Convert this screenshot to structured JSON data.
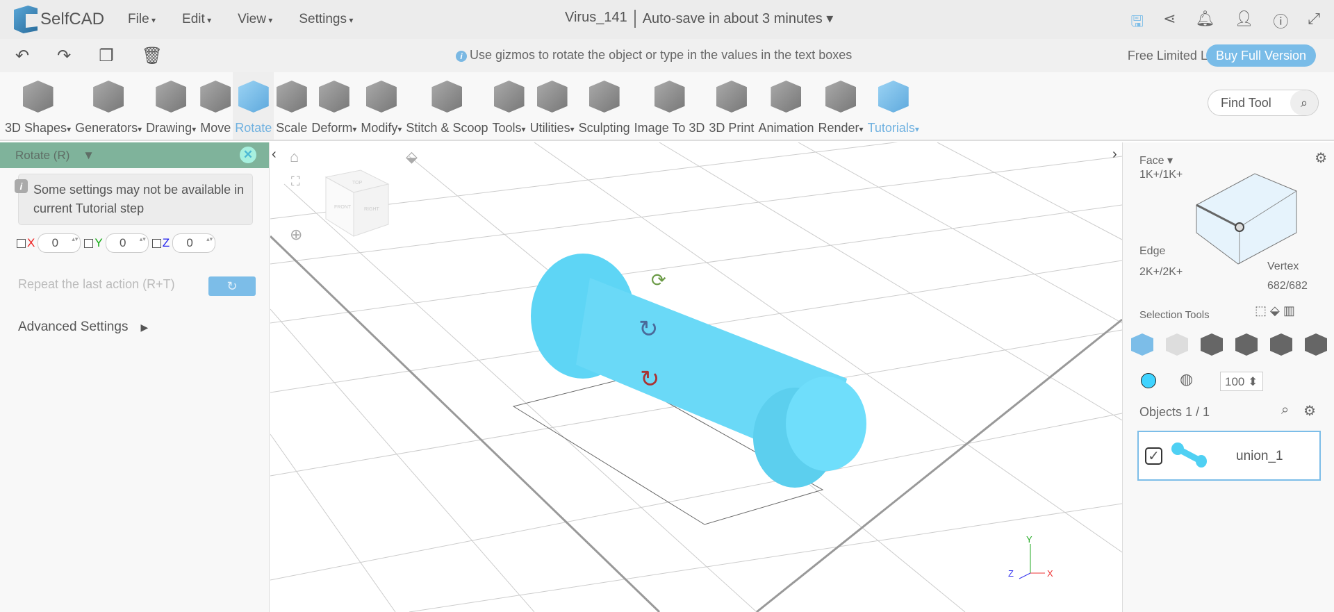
{
  "app": {
    "name": "SelfCAD",
    "menu": [
      "File",
      "Edit",
      "View",
      "Settings"
    ],
    "project": "Virus_141",
    "autosave": "Auto-save in about 3 minutes ▾"
  },
  "topicons": [
    "save-icon",
    "share-icon",
    "bell-icon",
    "user-icon",
    "info-icon",
    "fullscreen-icon"
  ],
  "bar2": {
    "hint": "Use gizmos to rotate the object or type in the values in the text boxes",
    "license": "Free Limited License",
    "buy": "Buy Full Version"
  },
  "toolbar": {
    "tools": [
      {
        "label": "3D Shapes",
        "dd": true
      },
      {
        "label": "Generators",
        "dd": true
      },
      {
        "label": "Drawing",
        "dd": true
      },
      {
        "label": "Move"
      },
      {
        "label": "Rotate",
        "active": true
      },
      {
        "label": "Scale"
      },
      {
        "label": "Deform",
        "dd": true
      },
      {
        "label": "Modify",
        "dd": true
      },
      {
        "label": "Stitch & Scoop"
      },
      {
        "label": "Tools",
        "dd": true
      },
      {
        "label": "Utilities",
        "dd": true
      },
      {
        "label": "Sculpting"
      },
      {
        "label": "Image To 3D"
      },
      {
        "label": "3D Print"
      },
      {
        "label": "Animation"
      },
      {
        "label": "Render",
        "dd": true
      },
      {
        "label": "Tutorials",
        "dd": true
      }
    ],
    "find": "Find Tool"
  },
  "panel": {
    "title": "Rotate (R)",
    "note": "Some settings may not be available in current Tutorial step",
    "x_label": "X",
    "y_label": "Y",
    "z_label": "Z",
    "x": "0",
    "y": "0",
    "z": "0",
    "repeat": "Repeat the last action (R+T)",
    "advanced": "Advanced Settings"
  },
  "viewcube": {
    "top": "TOP",
    "front": "FRONT",
    "right": "RIGHT"
  },
  "axes": {
    "x": "X",
    "y": "Y",
    "z": "Z"
  },
  "right": {
    "face": "Face",
    "face_count": "1K+/1K+",
    "edge": "Edge",
    "edge_count": "2K+/2K+",
    "vertex": "Vertex",
    "vertex_count": "682/682",
    "selection_tools": "Selection Tools",
    "opacity": "100",
    "objects": "Objects 1 / 1",
    "object_name": "union_1",
    "color": "#3fd3ff"
  }
}
